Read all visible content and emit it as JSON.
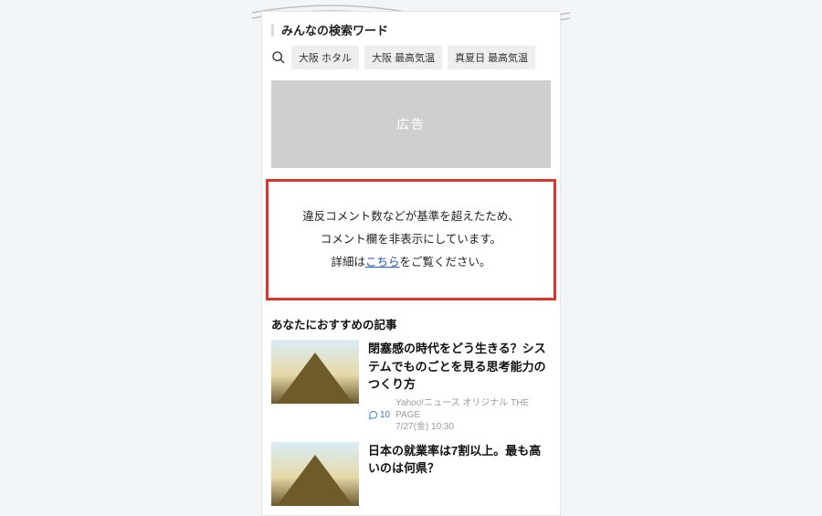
{
  "search_section": {
    "title": "みんなの検索ワード",
    "tags": [
      "大阪 ホタル",
      "大阪 最高気温",
      "真夏日 最高気温"
    ]
  },
  "ad": {
    "label": "広告"
  },
  "notice": {
    "line1": "違反コメント数などが基準を超えたため、",
    "line2": "コメント欄を非表示にしています。",
    "line3_prefix": "詳細は",
    "line3_link": "こちら",
    "line3_suffix": "をご覧ください。"
  },
  "recommend": {
    "title": "あなたにおすすめの記事",
    "articles": [
      {
        "title": "閉塞感の時代をどう生きる？システムでものごとを見る思考能力のつくり方",
        "comments": "10",
        "source": "Yahoo!ニュース オリジナル THE PAGE",
        "date": "7/27(金) 10:30"
      },
      {
        "title": "日本の就業率は7割以上。最も高いのは何県？",
        "comments": "",
        "source": "",
        "date": ""
      }
    ]
  }
}
